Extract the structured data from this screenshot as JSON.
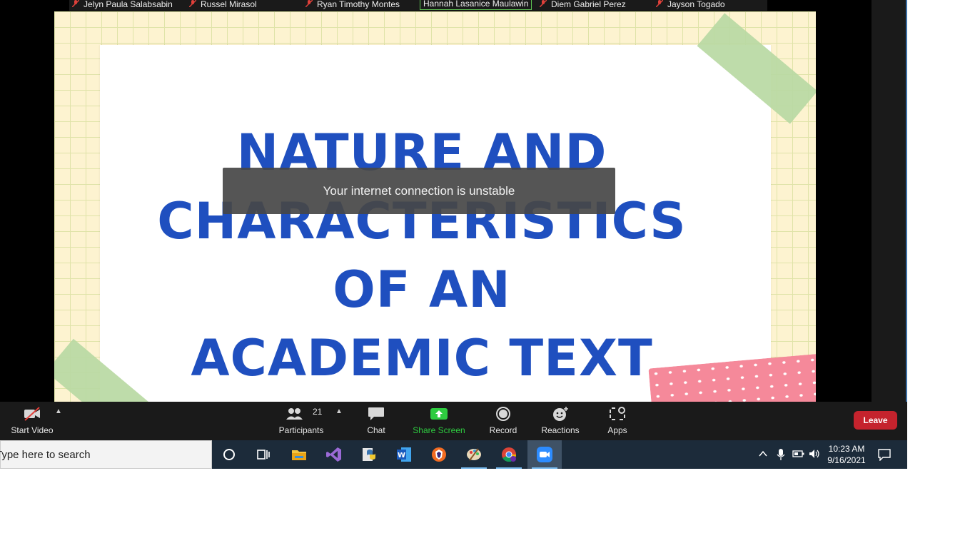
{
  "participants": [
    {
      "name": "Jelyn Paula Salabsabin",
      "muted": true
    },
    {
      "name": "Russel Mirasol",
      "muted": true
    },
    {
      "name": "Ryan Timothy Montes",
      "muted": true
    },
    {
      "name": "Hannah Lasanice Maulawin",
      "muted": false,
      "speaking": true
    },
    {
      "name": "Diem Gabriel Perez",
      "muted": true
    },
    {
      "name": "Jayson Togado",
      "muted": true
    }
  ],
  "slide": {
    "title_line1": "NATURE AND",
    "title_line2": "CHARACTERISTICS OF AN",
    "title_line3": "ACADEMIC TEXT"
  },
  "toast": {
    "message": "Your internet connection is unstable"
  },
  "toolbar": {
    "start_video": "Start Video",
    "participants_label": "Participants",
    "participants_count": "21",
    "chat": "Chat",
    "share_screen": "Share Screen",
    "record": "Record",
    "reactions": "Reactions",
    "apps": "Apps",
    "leave": "Leave"
  },
  "taskbar": {
    "search_placeholder": "Type here to search",
    "time": "10:23 AM",
    "date": "9/16/2021"
  },
  "colors": {
    "slide_title": "#1f4fbf",
    "share_screen": "#2ecc40",
    "leave": "#c5232d",
    "muted_mic": "#e0403a"
  }
}
